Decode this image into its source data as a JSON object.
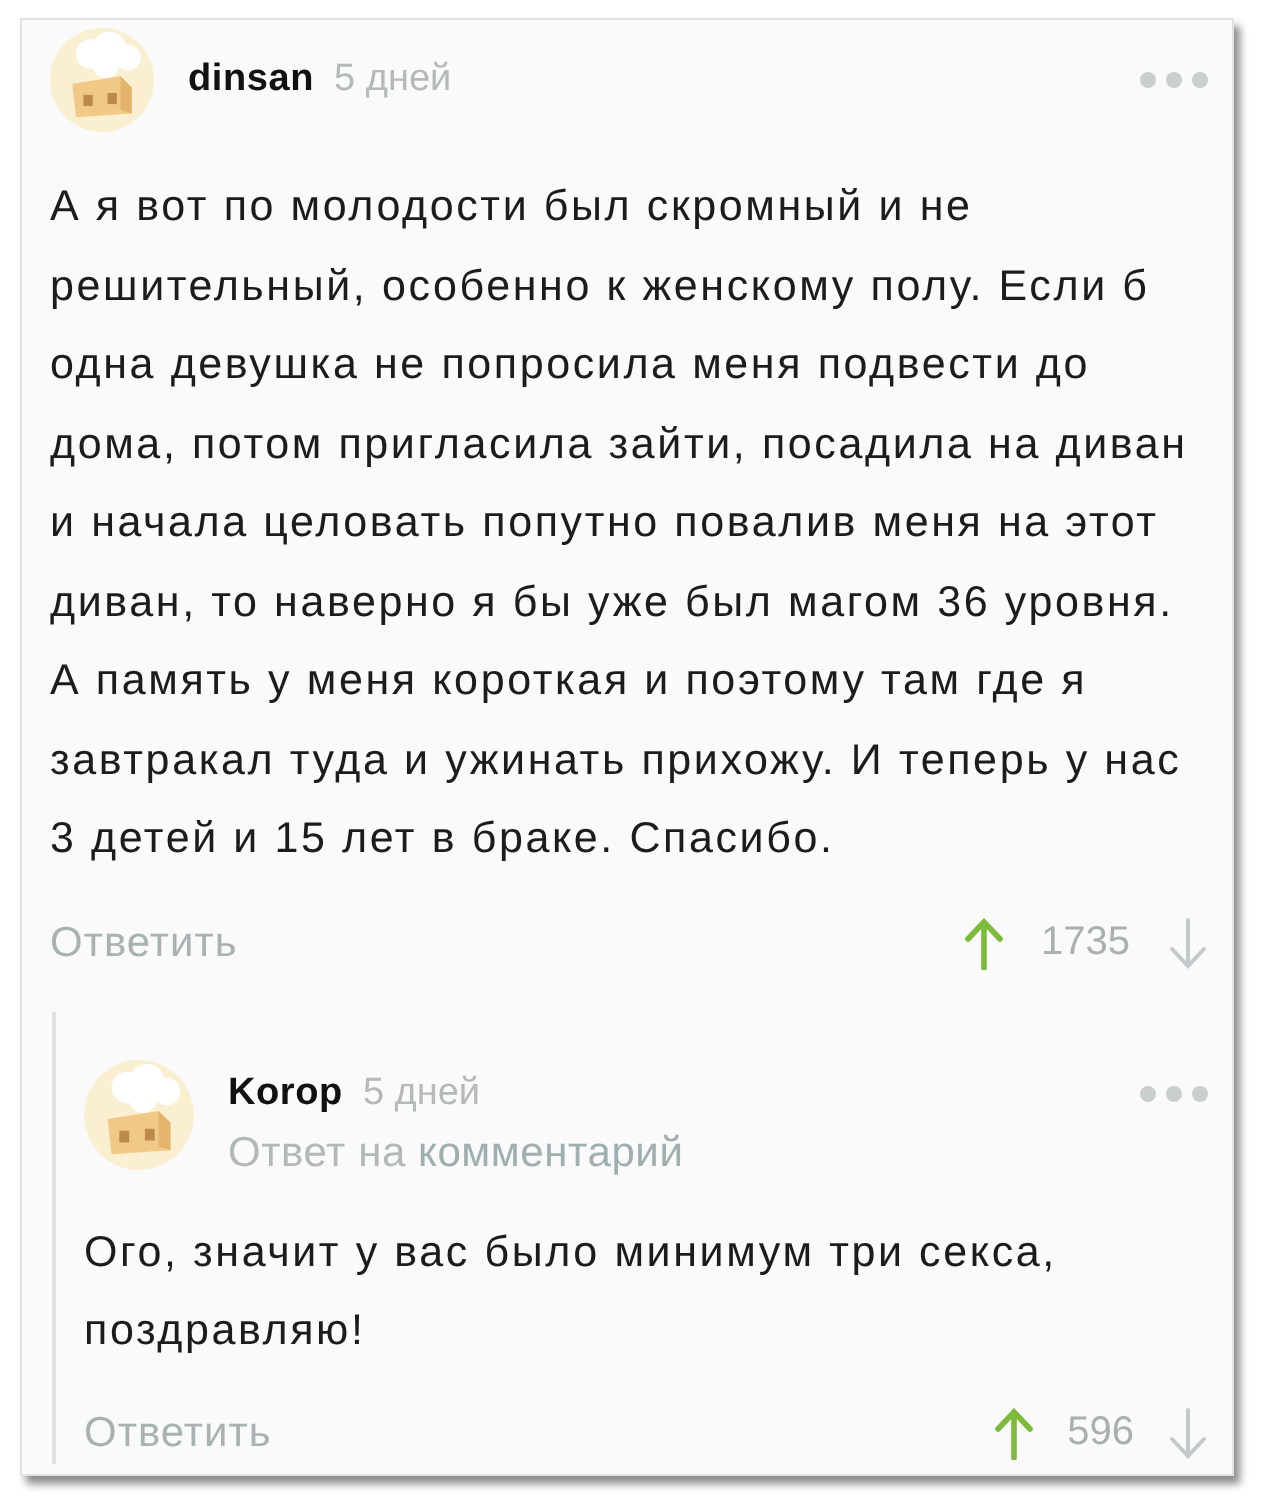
{
  "comment": {
    "author": "dinsan",
    "time": "5 дней",
    "text": "А я вот по молодости был скромный и не решительный, особенно к женскому полу. Если б одна девушка не попросила меня подвести до дома, потом пригласила зайти, посадила на диван и начала целовать попутно повалив меня на этот диван, то наверно я бы уже был магом 36 уровня. А память у меня короткая и поэтому там где я завтракал туда и ужинать прихожу. И теперь у нас 3 детей и 15 лет в браке. Спасибо.",
    "reply_button": "Ответить",
    "rating": "1735",
    "replies": [
      {
        "author": "Korop",
        "time": "5 дней",
        "reply_to": {
          "prefix": "Ответ на",
          "link": "комментарий"
        },
        "text": "Ого, значит у вас было минимум три секса, поздравляю!",
        "reply_button": "Ответить",
        "rating": "596"
      }
    ]
  }
}
